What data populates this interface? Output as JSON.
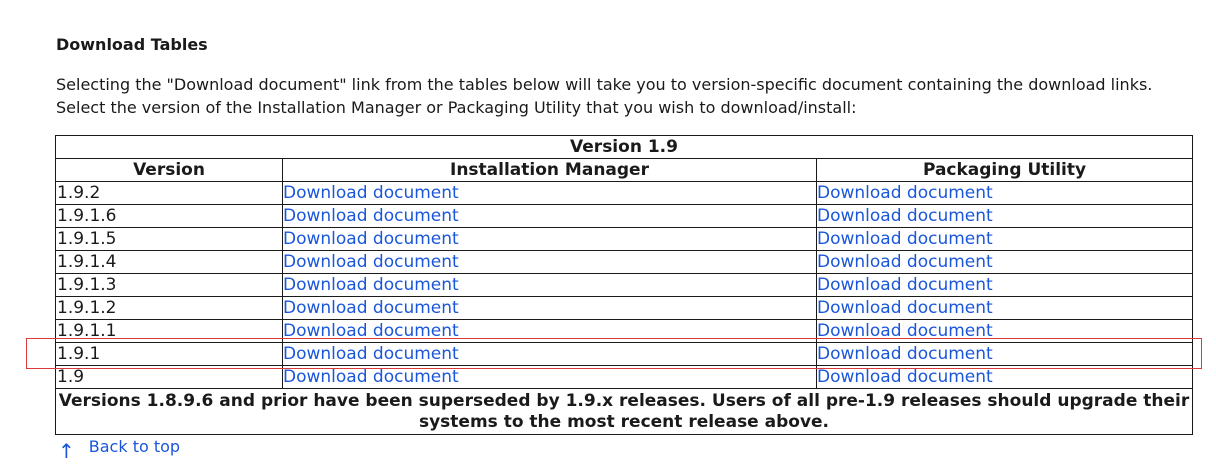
{
  "section": {
    "heading": "Download Tables",
    "intro": "Selecting the \"Download document\" link from the tables below will take you to version-specific document containing the download links. Select the version of the Installation Manager or Packaging Utility that you wish to download/install:"
  },
  "table": {
    "caption": "Version 1.9",
    "columns": [
      "Version",
      "Installation Manager",
      "Packaging Utility"
    ],
    "rows": [
      {
        "version": "1.9.2",
        "im_link": "Download document",
        "pu_link": "Download document"
      },
      {
        "version": "1.9.1.6",
        "im_link": "Download document",
        "pu_link": "Download document"
      },
      {
        "version": "1.9.1.5",
        "im_link": "Download document",
        "pu_link": "Download document"
      },
      {
        "version": "1.9.1.4",
        "im_link": "Download document",
        "pu_link": "Download document"
      },
      {
        "version": "1.9.1.3",
        "im_link": "Download document",
        "pu_link": "Download document"
      },
      {
        "version": "1.9.1.2",
        "im_link": "Download document",
        "pu_link": "Download document"
      },
      {
        "version": "1.9.1.1",
        "im_link": "Download document",
        "pu_link": "Download document"
      },
      {
        "version": "1.9.1",
        "im_link": "Download document",
        "pu_link": "Download document"
      },
      {
        "version": "1.9",
        "im_link": "Download document",
        "pu_link": "Download document"
      }
    ],
    "footer": "Versions 1.8.9.6 and prior have been superseded by 1.9.x releases. Users of all pre-1.9 releases should upgrade their systems to the most recent release above."
  },
  "back_to_top": {
    "icon": "arrow-up-icon",
    "label": "Back to top"
  },
  "colors": {
    "link": "#1a56db",
    "highlight_border": "#d93b3b",
    "border": "#1a1a1a"
  }
}
